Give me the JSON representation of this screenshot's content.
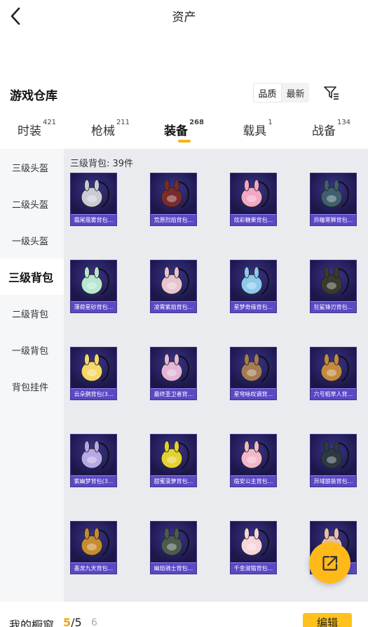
{
  "topbar": {
    "title": "资产"
  },
  "warehouse": {
    "title": "游戏仓库",
    "sort": [
      "品质",
      "最新"
    ]
  },
  "tabs": [
    {
      "label": "时装",
      "count": "421"
    },
    {
      "label": "枪械",
      "count": "211"
    },
    {
      "label": "装备",
      "count": "268",
      "active": true
    },
    {
      "label": "载具",
      "count": "1"
    },
    {
      "label": "战备",
      "count": "134"
    }
  ],
  "sidemenu": [
    "三级头盔",
    "二级头盔",
    "一级头盔",
    "三级背包",
    "二级背包",
    "一级背包",
    "背包挂件"
  ],
  "grid": {
    "heading": "三级背包: 39件",
    "items": [
      {
        "label": "霜尾蔻雾背包...",
        "color": "#c9ccd6"
      },
      {
        "label": "荒原烈焰背包...",
        "color": "#7a2b2b"
      },
      {
        "label": "炫彩糖果背包...",
        "color": "#f2a7c4"
      },
      {
        "label": "异瞳寒狮背包...",
        "color": "#3f5f6e"
      },
      {
        "label": "薄荷星砂背包...",
        "color": "#b9e6cf"
      },
      {
        "label": "凌霄紫焰背包...",
        "color": "#e8c4cf"
      },
      {
        "label": "星梦奇缘背包...",
        "color": "#8ec9ec"
      },
      {
        "label": "狂鲨锋刃背包...",
        "color": "#3b3a2e"
      },
      {
        "label": "云朵鹊背包(3...",
        "color": "#f4d86a"
      },
      {
        "label": "最终圣卫者背...",
        "color": "#e3b6d6"
      },
      {
        "label": "星穹咏叹调背...",
        "color": "#a37b54"
      },
      {
        "label": "六号稻草人背...",
        "color": "#c48a3f"
      },
      {
        "label": "紫幽梦背包(3...",
        "color": "#b7a8e6"
      },
      {
        "label": "甜蜜菠萝背包...",
        "color": "#e3d230"
      },
      {
        "label": "临安公主背包...",
        "color": "#f1b8c8"
      },
      {
        "label": "异域狼装背包...",
        "color": "#2c3a44"
      },
      {
        "label": "墨龙九天背包...",
        "color": "#c68c2f"
      },
      {
        "label": "幽焰骑士背包...",
        "color": "#4c5a50"
      },
      {
        "label": "千金淑猫背包...",
        "color": "#f4d6dc"
      },
      {
        "label": "",
        "color": "#e7c0b0"
      }
    ]
  },
  "bottombar": {
    "label": "我的橱窗",
    "current": "5",
    "total": "/5",
    "extra": "6",
    "edit": "编辑"
  },
  "icons": [
    "back-arrow-icon",
    "filter-icon",
    "share-icon"
  ]
}
